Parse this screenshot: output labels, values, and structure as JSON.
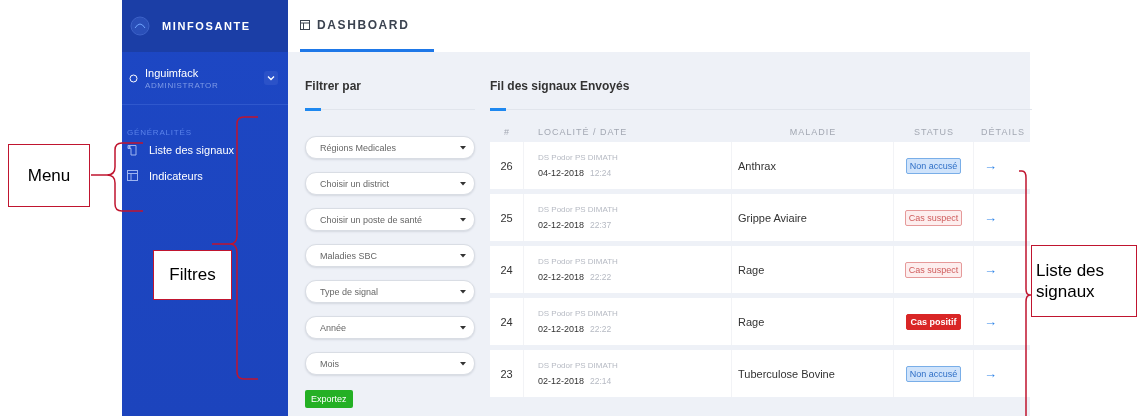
{
  "sidebar": {
    "brand": "MINFOSANTE",
    "user": {
      "name": "Inguimfack",
      "role": "ADMINISTRATOR"
    },
    "section": "GÉNÉRALITÉS",
    "items": [
      {
        "label": "Liste des signaux"
      },
      {
        "label": "Indicateurs"
      }
    ]
  },
  "tabs": [
    {
      "label": "DASHBOARD",
      "selected": true
    }
  ],
  "filters": {
    "title": "Filtrer par",
    "selects": [
      "Régions Medicales",
      "Choisir un district",
      "Choisir un poste de santé",
      "Maladies SBC",
      "Type de signal",
      "Année",
      "Mois"
    ],
    "export_button": "Exportez"
  },
  "signals": {
    "title": "Fil des signaux Envoyés",
    "columns": [
      "#",
      "LOCALITÉ / DATE",
      "MALADIE",
      "STATUS",
      "DÉTAILS"
    ],
    "rows": [
      {
        "number": "26",
        "place": "DS Podor PS DIMATH",
        "date": "04-12-2018",
        "time": "12:24",
        "disease": "Anthrax",
        "status": {
          "label": "Non accusé",
          "kind": "pending"
        },
        "details": "→"
      },
      {
        "number": "25",
        "place": "DS Podor PS DIMATH",
        "date": "02-12-2018",
        "time": "22:37",
        "disease": "Grippe Aviaire",
        "status": {
          "label": "Cas suspect",
          "kind": "suspect"
        },
        "details": "→"
      },
      {
        "number": "24",
        "place": "DS Podor PS DIMATH",
        "date": "02-12-2018",
        "time": "22:22",
        "disease": "Rage",
        "status": {
          "label": "Cas suspect",
          "kind": "suspect"
        },
        "details": "→"
      },
      {
        "number": "24",
        "place": "DS Podor PS DIMATH",
        "date": "02-12-2018",
        "time": "22:22",
        "disease": "Rage",
        "status": {
          "label": "Cas positif",
          "kind": "positive"
        },
        "details": "→"
      },
      {
        "number": "23",
        "place": "DS Podor PS DIMATH",
        "date": "02-12-2018",
        "time": "22:14",
        "disease": "Tuberculose Bovine",
        "status": {
          "label": "Non accusé",
          "kind": "pending"
        },
        "details": "→"
      }
    ]
  },
  "annotations": [
    {
      "label": "Menu"
    },
    {
      "label": "Filtres"
    },
    {
      "label": "Liste des signaux"
    }
  ]
}
